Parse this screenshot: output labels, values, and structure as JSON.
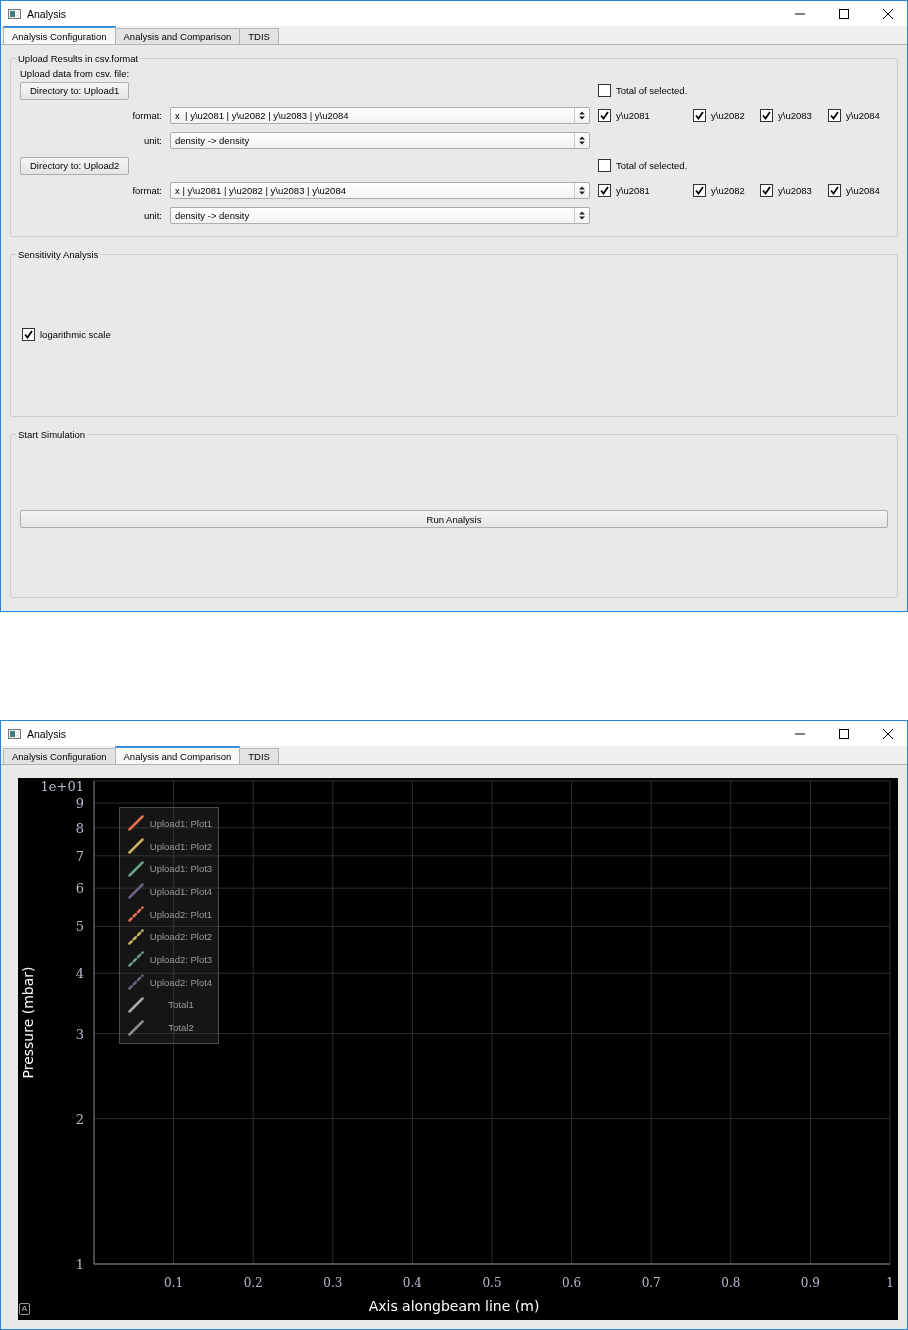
{
  "config_window": {
    "title": "Analysis",
    "tabs": [
      {
        "label": "Analysis Configuration",
        "selected": true
      },
      {
        "label": "Analysis and Comparison",
        "selected": false
      },
      {
        "label": "TDIS",
        "selected": false
      }
    ],
    "upload_group": {
      "title": "Upload Results in csv.format",
      "hint": "Upload data from csv. file:",
      "uploads": [
        {
          "button": "Directory to: Upload1",
          "total": {
            "label": "Total of selected.",
            "checked": false
          },
          "format": {
            "label": "format:",
            "value": "x  | y\\u2081 | y\\u2082 | y\\u2083 | y\\u2084"
          },
          "channels": [
            {
              "label": "y\\u2081",
              "checked": true
            },
            {
              "label": "y\\u2082",
              "checked": true
            },
            {
              "label": "y\\u2083",
              "checked": true
            },
            {
              "label": "y\\u2084",
              "checked": true
            }
          ],
          "unit": {
            "label": "unit:",
            "value": "density -> density"
          }
        },
        {
          "button": "Directory to: Upload2",
          "total": {
            "label": "Total of selected.",
            "checked": false
          },
          "format": {
            "label": "format:",
            "value": "x | y\\u2081 | y\\u2082 | y\\u2083 | y\\u2084"
          },
          "channels": [
            {
              "label": "y\\u2081",
              "checked": true
            },
            {
              "label": "y\\u2082",
              "checked": true
            },
            {
              "label": "y\\u2083",
              "checked": true
            },
            {
              "label": "y\\u2084",
              "checked": true
            }
          ],
          "unit": {
            "label": "unit:",
            "value": "density -> density"
          }
        }
      ]
    },
    "sensitivity_group": {
      "title": "Sensitivity Analysis",
      "log_scale": {
        "label": "logarithmic scale",
        "checked": true
      }
    },
    "simulation_group": {
      "title": "Start Simulation",
      "button": "Run Analysis"
    }
  },
  "comparison_window": {
    "title": "Analysis",
    "tabs": [
      {
        "label": "Analysis Configuration",
        "selected": false
      },
      {
        "label": "Analysis and Comparison",
        "selected": true
      },
      {
        "label": "TDIS",
        "selected": false
      }
    ],
    "chart": {
      "x_axis": {
        "title": "Axis alongbeam line (m)",
        "ticks": [
          "0.1",
          "0.2",
          "0.3",
          "0.4",
          "0.5",
          "0.6",
          "0.7",
          "0.8",
          "0.9",
          "1"
        ]
      },
      "y_axis": {
        "title": "Pressure (mbar)",
        "ticks": [
          "1e+01",
          "9",
          "8",
          "7",
          "6",
          "5",
          "4",
          "3",
          "2",
          "1"
        ]
      },
      "legend": [
        {
          "label": "Upload1: Plot1",
          "color": "#e2704f",
          "kind": "solid"
        },
        {
          "label": "Upload1: Plot2",
          "color": "#c9b25c",
          "kind": "solid"
        },
        {
          "label": "Upload1: Plot3",
          "color": "#6a9f86",
          "kind": "solid"
        },
        {
          "label": "Upload1: Plot4",
          "color": "#6e6080",
          "kind": "solid"
        },
        {
          "label": "Upload2: Plot1",
          "color": "#e2704f",
          "kind": "dashed"
        },
        {
          "label": "Upload2: Plot2",
          "color": "#c9b25c",
          "kind": "dashed"
        },
        {
          "label": "Upload2: Plot3",
          "color": "#6a9f86",
          "kind": "dashed"
        },
        {
          "label": "Upload2: Plot4",
          "color": "#6e6080",
          "kind": "dashed"
        },
        {
          "label": "Total1",
          "color": "#a8a8a8",
          "kind": "solid"
        },
        {
          "label": "Total2",
          "color": "#8c8c8c",
          "kind": "solid"
        }
      ],
      "autoscale_button": "A"
    }
  }
}
